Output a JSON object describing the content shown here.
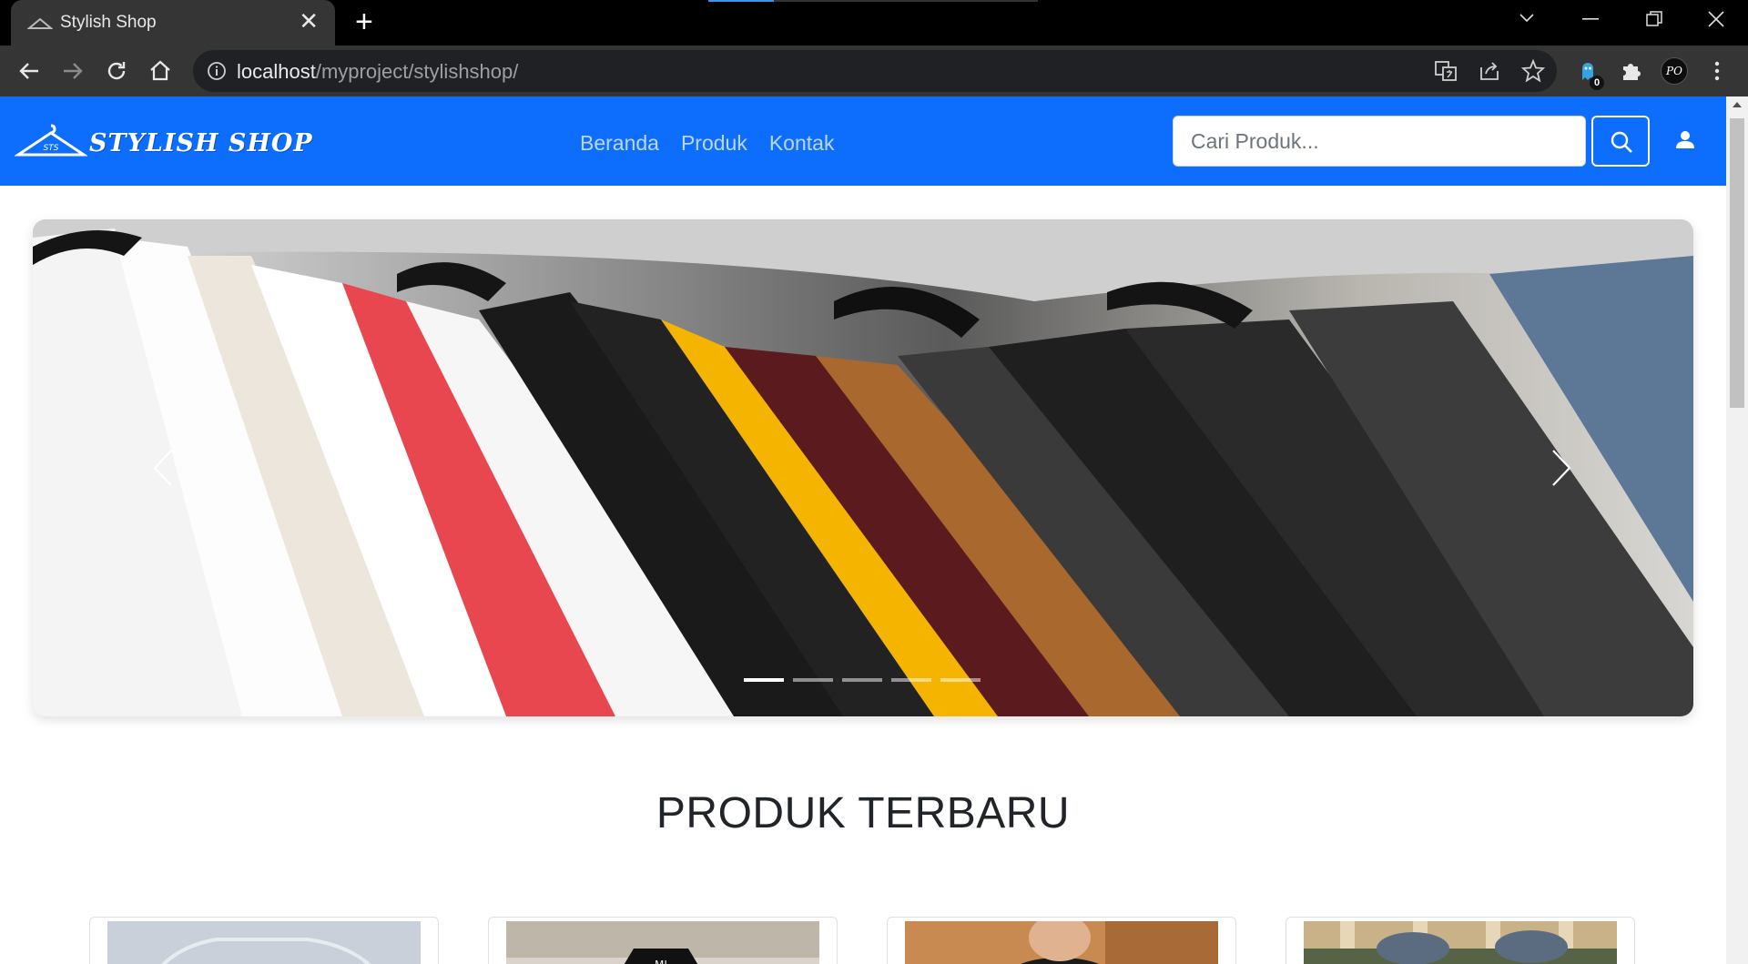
{
  "browser": {
    "tab_title": "Stylish Shop",
    "close_tab_label": "✕",
    "new_tab_label": "+",
    "url_host": "localhost",
    "url_path": "/myproject/stylishshop/",
    "extension_badge": "0",
    "profile_initials": "PO"
  },
  "nav": {
    "brand": "STYLISH SHOP",
    "logo_mark": "STS",
    "links": [
      "Beranda",
      "Produk",
      "Kontak"
    ],
    "search_placeholder": "Cari Produk...",
    "colors": {
      "primary": "#0d6efd"
    }
  },
  "carousel": {
    "slide_count": 5,
    "active_index": 0
  },
  "section": {
    "title": "PRODUK TERBARU"
  },
  "products": [
    {
      "icon": "product-image"
    },
    {
      "icon": "product-image"
    },
    {
      "icon": "product-image"
    },
    {
      "icon": "product-image"
    }
  ]
}
